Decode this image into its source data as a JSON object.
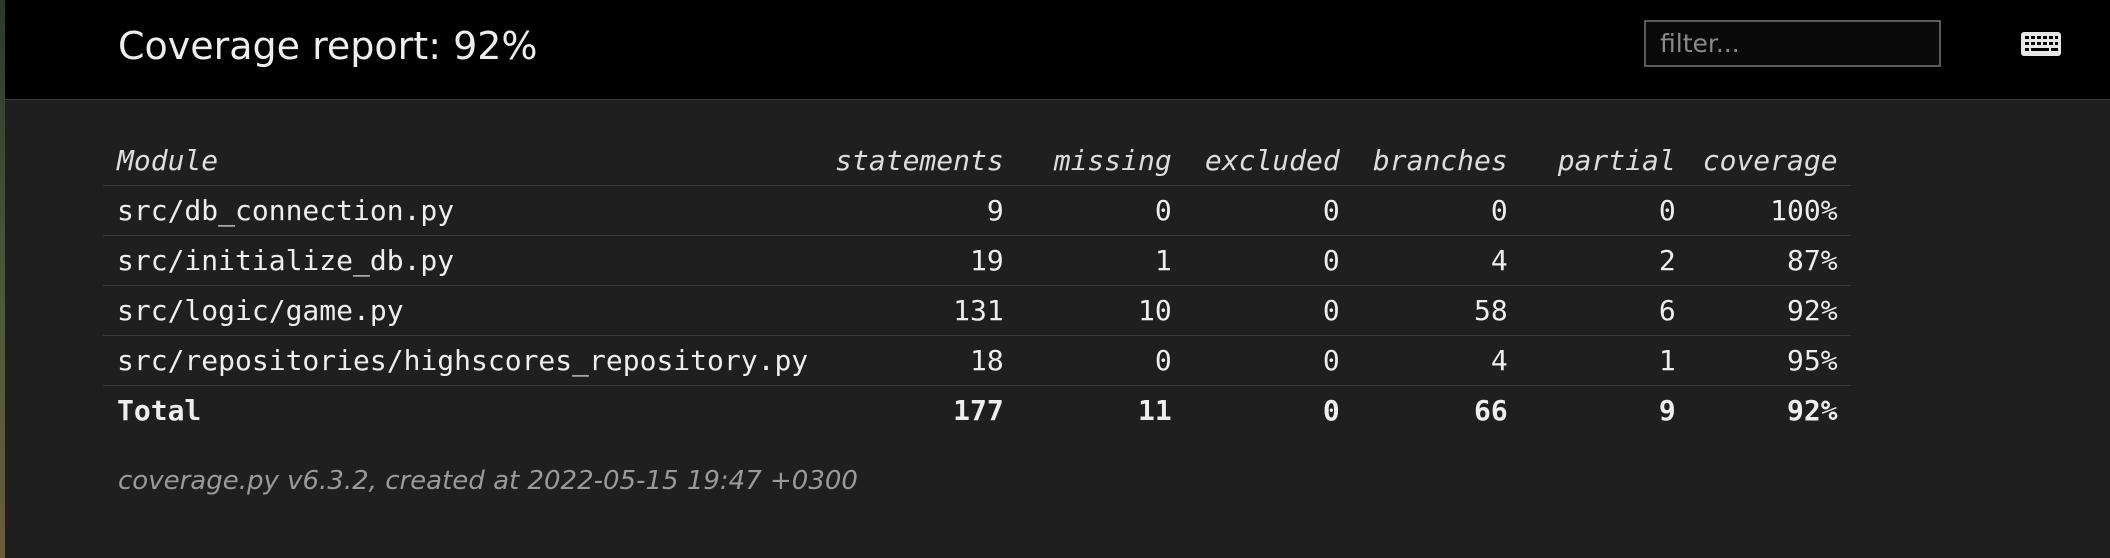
{
  "header": {
    "title": "Coverage report: 92%",
    "filter_placeholder": "filter...",
    "filter_value": "",
    "keyboard_icon": "keyboard-icon"
  },
  "table": {
    "columns": [
      "Module",
      "statements",
      "missing",
      "excluded",
      "branches",
      "partial",
      "coverage"
    ],
    "rows": [
      {
        "module": "src/db_connection.py",
        "statements": "9",
        "missing": "0",
        "excluded": "0",
        "branches": "0",
        "partial": "0",
        "coverage": "100%"
      },
      {
        "module": "src/initialize_db.py",
        "statements": "19",
        "missing": "1",
        "excluded": "0",
        "branches": "4",
        "partial": "2",
        "coverage": "87%"
      },
      {
        "module": "src/logic/game.py",
        "statements": "131",
        "missing": "10",
        "excluded": "0",
        "branches": "58",
        "partial": "6",
        "coverage": "92%"
      },
      {
        "module": "src/repositories/highscores_repository.py",
        "statements": "18",
        "missing": "0",
        "excluded": "0",
        "branches": "4",
        "partial": "1",
        "coverage": "95%"
      }
    ],
    "total": {
      "module": "Total",
      "statements": "177",
      "missing": "11",
      "excluded": "0",
      "branches": "66",
      "partial": "9",
      "coverage": "92%"
    }
  },
  "footer": {
    "text": "coverage.py v6.3.2, created at 2022-05-15 19:47 +0300"
  },
  "colors": {
    "background": "#1f1f1f",
    "header_background": "#000000",
    "text": "#eeeeee",
    "footer_text": "#9a9a9a",
    "row_border": "#3a3a3a"
  }
}
